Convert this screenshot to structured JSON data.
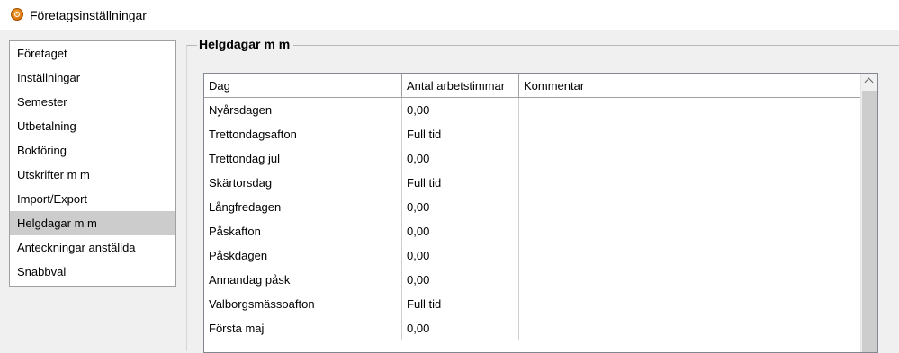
{
  "window": {
    "title": "Företagsinställningar",
    "icon": "app-logo-icon"
  },
  "nav": {
    "items": [
      {
        "label": "Företaget",
        "selected": false
      },
      {
        "label": "Inställningar",
        "selected": false
      },
      {
        "label": "Semester",
        "selected": false
      },
      {
        "label": "Utbetalning",
        "selected": false
      },
      {
        "label": "Bokföring",
        "selected": false
      },
      {
        "label": "Utskrifter m m",
        "selected": false
      },
      {
        "label": "Import/Export",
        "selected": false
      },
      {
        "label": "Helgdagar m m",
        "selected": true
      },
      {
        "label": "Anteckningar anställda",
        "selected": false
      },
      {
        "label": "Snabbval",
        "selected": false
      }
    ]
  },
  "section": {
    "title": "Helgdagar m m"
  },
  "grid": {
    "columns": [
      "Dag",
      "Antal arbetstimmar",
      "Kommentar"
    ],
    "rows": [
      {
        "day": "Nyårsdagen",
        "hours": "0,00",
        "comment": ""
      },
      {
        "day": "Trettondagsafton",
        "hours": "Full tid",
        "comment": ""
      },
      {
        "day": "Trettondag jul",
        "hours": "0,00",
        "comment": ""
      },
      {
        "day": "Skärtorsdag",
        "hours": "Full tid",
        "comment": ""
      },
      {
        "day": "Långfredagen",
        "hours": "0,00",
        "comment": ""
      },
      {
        "day": "Påskafton",
        "hours": "0,00",
        "comment": ""
      },
      {
        "day": "Påskdagen",
        "hours": "0,00",
        "comment": ""
      },
      {
        "day": "Annandag påsk",
        "hours": "0,00",
        "comment": ""
      },
      {
        "day": "Valborgsmässoafton",
        "hours": "Full tid",
        "comment": ""
      },
      {
        "day": "Första maj",
        "hours": "0,00",
        "comment": ""
      }
    ]
  },
  "colors": {
    "selected_item_bg": "#cccccc",
    "scroll_thumb": "#cdcdcd",
    "accent_icon": "#e07a10"
  }
}
